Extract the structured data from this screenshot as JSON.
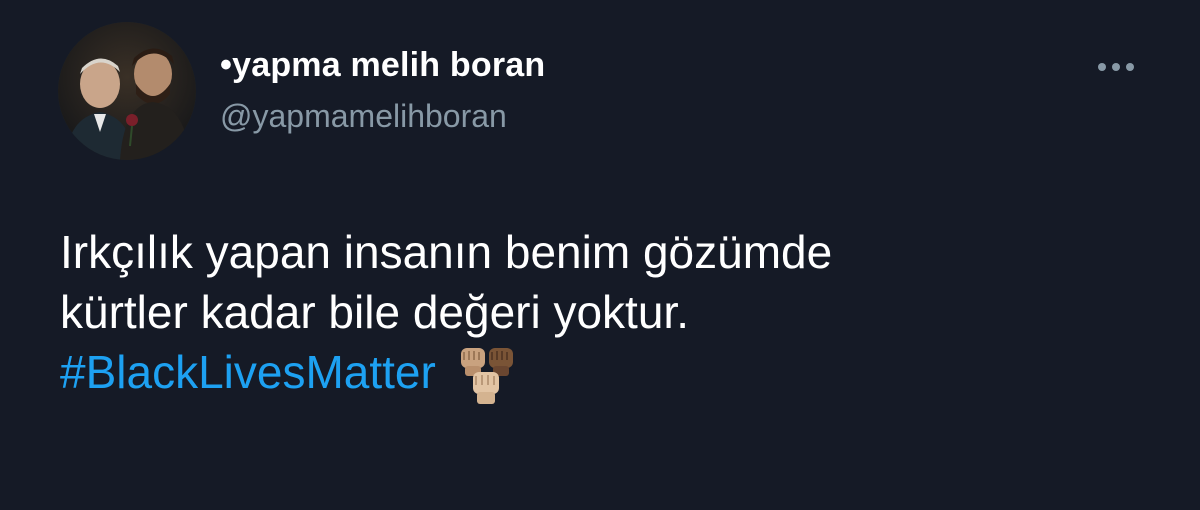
{
  "tweet": {
    "author": {
      "display_name": "•yapma melih boran",
      "handle": "@yapmamelihboran",
      "avatar_icon": "profile-photo"
    },
    "more_icon": "more-dots-icon",
    "text_lines": [
      "Irkçılık yapan insanın benim gözümde",
      "kürtler kadar bile değeri yoktur."
    ],
    "hashtag": "#BlackLivesMatter",
    "emoji_icon": "raised-fists-emoji"
  },
  "colors": {
    "background": "#151a26",
    "text": "#ffffff",
    "secondary_text": "#8899a6",
    "link": "#1da1f2"
  }
}
